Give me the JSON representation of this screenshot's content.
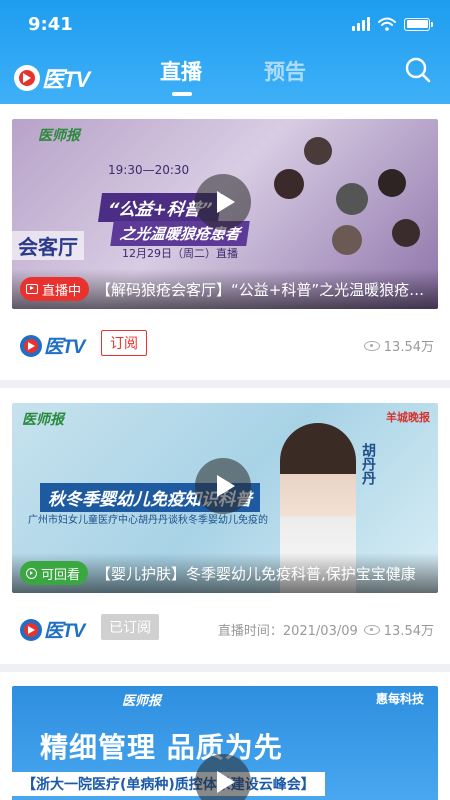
{
  "status_bar": {
    "time": "9:41"
  },
  "header": {
    "logo_text": "医TV",
    "tabs": [
      {
        "label": "直播",
        "active": true
      },
      {
        "label": "预告",
        "active": false
      }
    ]
  },
  "colors": {
    "primary": "#1e9df0",
    "live": "#e8322d",
    "replay": "#3aa741",
    "subscribed": "#d0d0d0"
  },
  "feed": [
    {
      "status": "直播中",
      "title": "【解码狼疮会客厅】“公益+科普”之光温暖狼疮患者",
      "source": "医TV",
      "subscribe_label": "订阅",
      "subscribed": false,
      "live_time_label": "",
      "views": "13.54万",
      "thumbnail_text": {
        "brand": "医师报",
        "headline_1": "“公益+科普”",
        "headline_2": "之光温暖狼疮患者",
        "left_label": "会客厅",
        "date": "12月29日（周二）直播",
        "time": "19:30—20:30"
      }
    },
    {
      "status": "可回看",
      "title": "【婴儿护肤】冬季婴幼儿免疫科普,保护宝宝健康",
      "source": "医TV",
      "subscribe_label": "已订阅",
      "subscribed": true,
      "live_time_label": "直播时间：2021/03/09",
      "views": "13.54万",
      "thumbnail_text": {
        "brand": "医师报",
        "headline_1": "秋冬季婴幼儿免疫知识科普",
        "headline_2": "广州市妇女儿童医疗中心胡丹丹谈秋冬季婴幼儿免疫的防治",
        "name": "胡丹丹",
        "right_brand": "羊城晚报"
      }
    },
    {
      "status": "",
      "title": "",
      "thumbnail_text": {
        "brand": "医师报",
        "headline_1": "精细管理 品质为先",
        "headline_2": "【浙大一院医疗(单病种)质控体系建设云峰会】",
        "right_brand": "惠每科技"
      }
    }
  ]
}
